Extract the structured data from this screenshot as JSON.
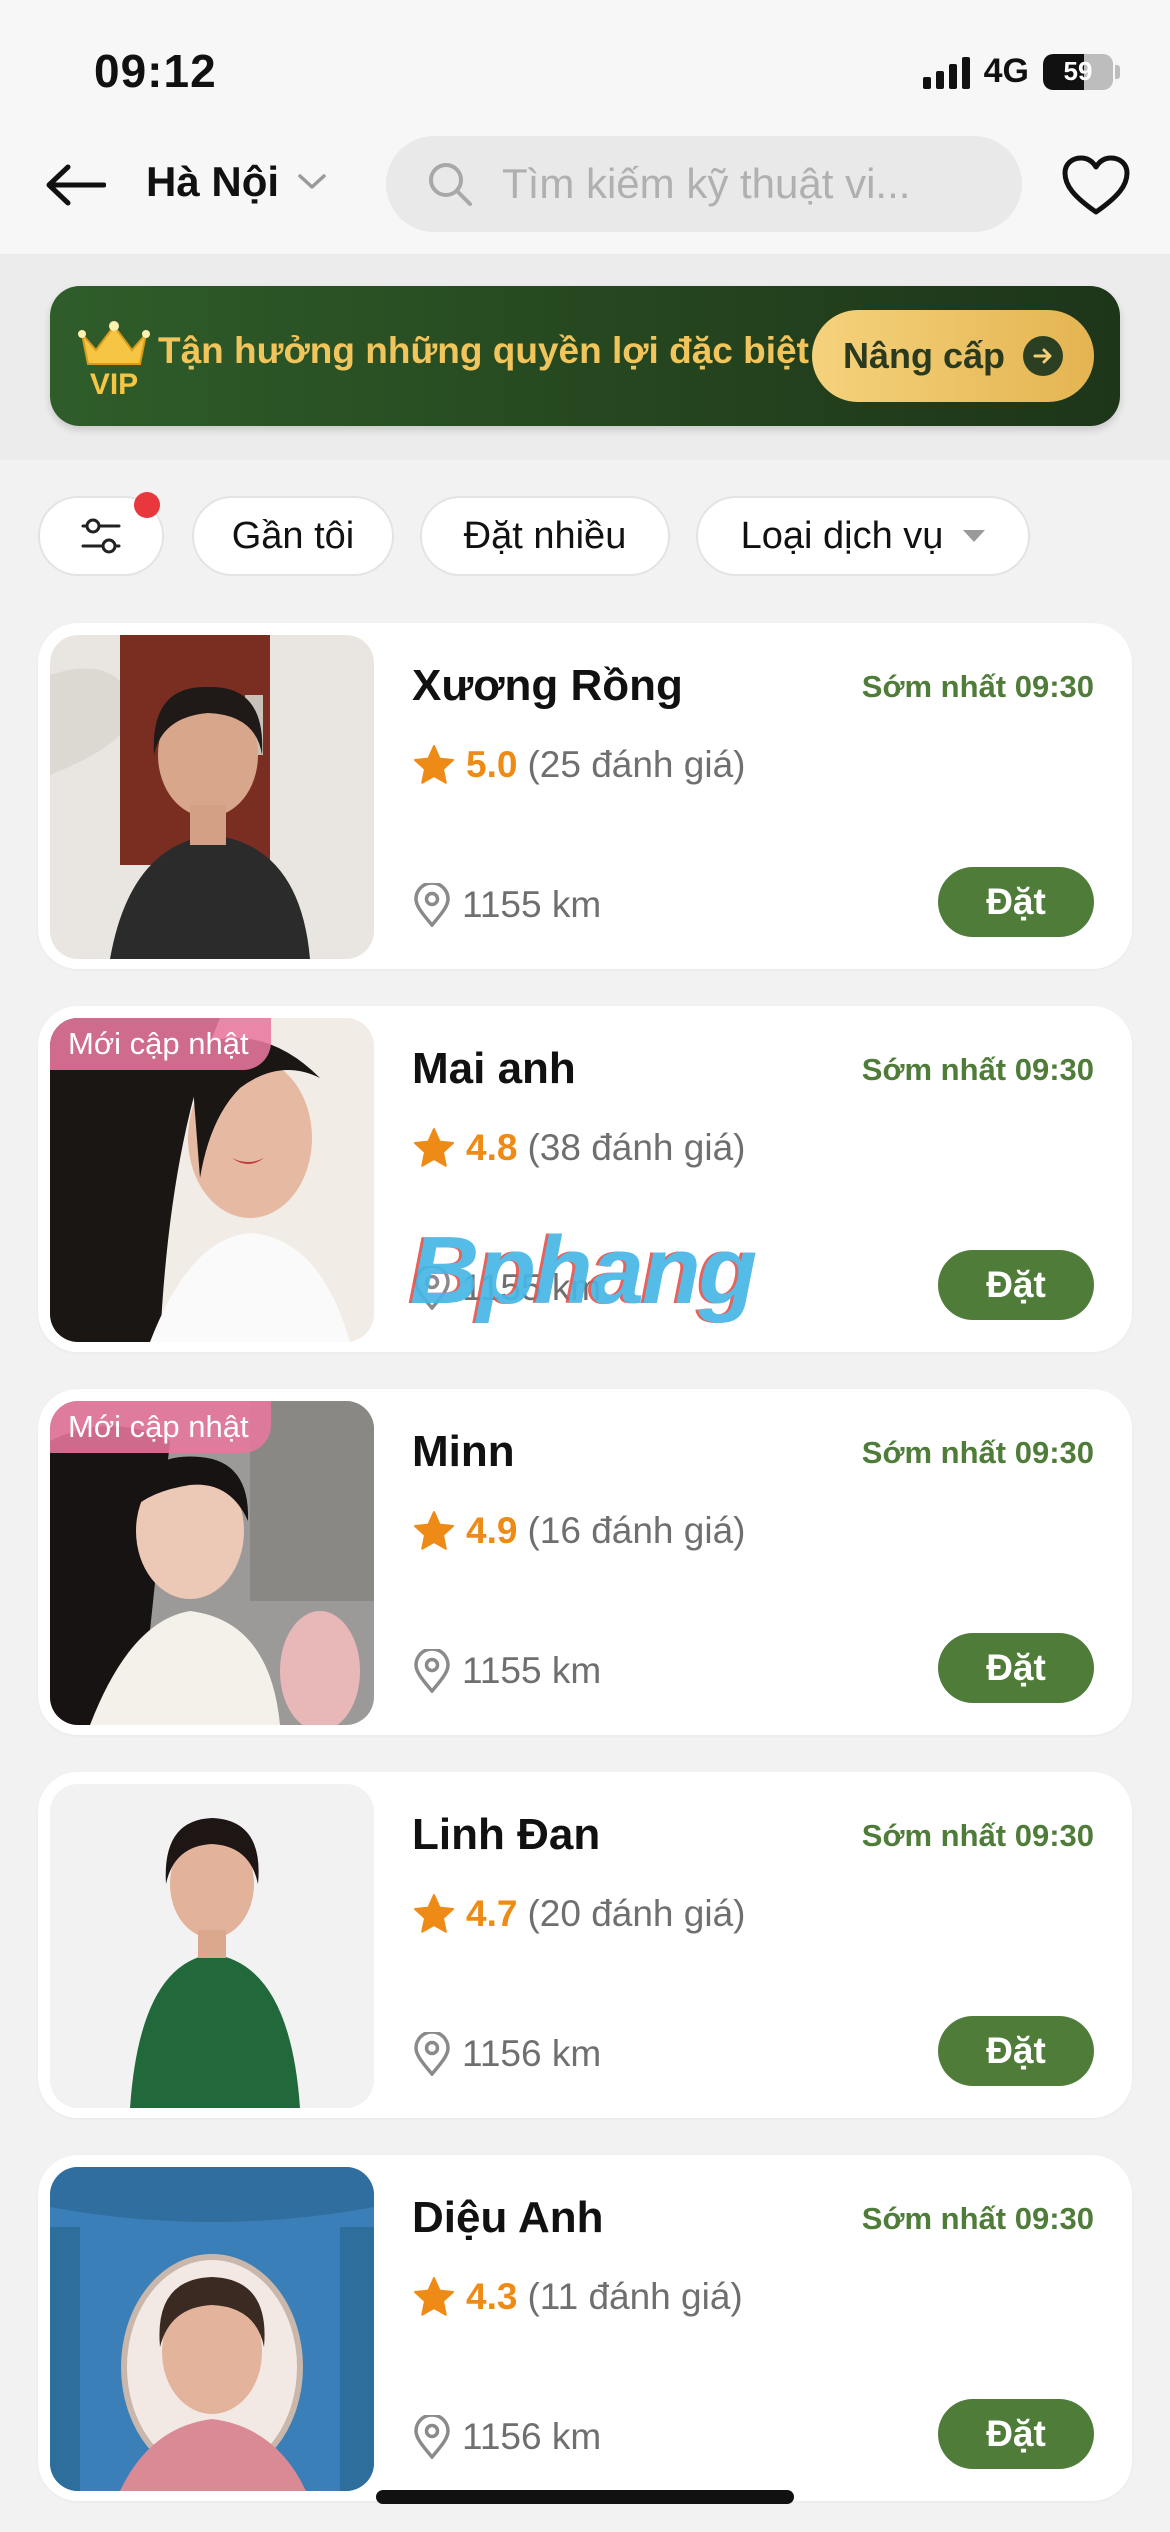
{
  "status_bar": {
    "time": "09:12",
    "network": "4G",
    "battery": "59",
    "battery_level": 0.59
  },
  "header": {
    "city": "Hà Nội",
    "search_placeholder": "Tìm kiếm kỹ thuật vi...",
    "icons": [
      "back-arrow-icon",
      "chevron-down-icon",
      "search-icon",
      "heart-icon"
    ]
  },
  "vip_banner": {
    "icon_text": "VIP",
    "text": "Tận hưởng những quyền lợi đặc biệt",
    "button_label": "Nâng cấp"
  },
  "filters": {
    "chips": [
      "Gần tôi",
      "Đặt nhiều",
      "Loại dịch vụ"
    ],
    "filter_icon": "sliders-icon",
    "has_notification_dot": true
  },
  "colors": {
    "primary_green": "#4f7d39",
    "rating_orange": "#ee8b16",
    "vip_gold": "#f2c55c",
    "badge_pink": "#e8789e",
    "notification_red": "#e8383d"
  },
  "technicians": [
    {
      "name": "Xương Rồng",
      "earliest": "Sớm nhất 09:30",
      "rating": "5.0",
      "reviews": "(25 đánh giá)",
      "distance": "1155 km",
      "book_label": "Đặt",
      "badge": ""
    },
    {
      "name": "Mai anh",
      "earliest": "Sớm nhất 09:30",
      "rating": "4.8",
      "reviews": "(38 đánh giá)",
      "distance": "1155 km",
      "book_label": "Đặt",
      "badge": "Mới cập nhật"
    },
    {
      "name": "Minn",
      "earliest": "Sớm nhất 09:30",
      "rating": "4.9",
      "reviews": "(16 đánh giá)",
      "distance": "1155 km",
      "book_label": "Đặt",
      "badge": "Mới cập nhật"
    },
    {
      "name": "Linh Đan",
      "earliest": "Sớm nhất 09:30",
      "rating": "4.7",
      "reviews": "(20 đánh giá)",
      "distance": "1156 km",
      "book_label": "Đặt",
      "badge": ""
    },
    {
      "name": "Diệu Anh",
      "earliest": "Sớm nhất 09:30",
      "rating": "4.3",
      "reviews": "(11 đánh giá)",
      "distance": "1156 km",
      "book_label": "Đặt",
      "badge": ""
    }
  ],
  "watermark": "Bphang"
}
